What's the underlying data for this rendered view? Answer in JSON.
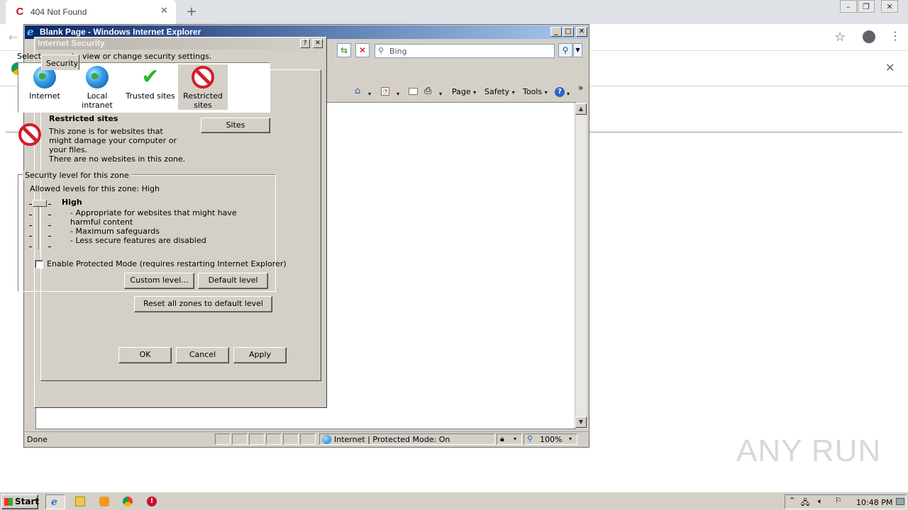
{
  "chrome": {
    "tab_title": "404 Not Found",
    "tab_icon": "comodo-icon"
  },
  "ie": {
    "window_title": "Blank Page - Windows Internet Explorer",
    "search_placeholder": "Bing",
    "commands": {
      "page": "Page",
      "safety": "Safety",
      "tools": "Tools"
    },
    "status": {
      "done": "Done",
      "zone": "Internet | Protected Mode: On",
      "zoom": "100%"
    }
  },
  "dialog": {
    "title": "Internet Security",
    "tab_label": "Security",
    "zone_prompt": "Select a zone to view or change security settings.",
    "zones": [
      {
        "label": "Internet"
      },
      {
        "label": "Local intranet"
      },
      {
        "label": "Trusted sites"
      },
      {
        "label": "Restricted sites",
        "selected": true
      }
    ],
    "detail": {
      "title": "Restricted sites",
      "description": "This zone is for websites that might damage your computer or your files.",
      "no_sites": "There are no websites in this zone.",
      "sites_button": "Sites"
    },
    "level": {
      "legend": "Security level for this zone",
      "allowed": "Allowed levels for this zone: High",
      "name": "High",
      "bullets": [
        "- Appropriate for websites that might have harmful content",
        "- Maximum safeguards",
        "- Less secure features are disabled"
      ],
      "protected_mode_label": "Enable Protected Mode (requires restarting Internet Explorer)",
      "protected_mode_checked": false,
      "custom_button": "Custom level...",
      "default_button": "Default level"
    },
    "reset_button": "Reset all zones to default level",
    "ok": "OK",
    "cancel": "Cancel",
    "apply": "Apply"
  },
  "taskbar": {
    "start": "Start",
    "clock": "10:48 PM"
  },
  "watermark": "ANY RUN"
}
